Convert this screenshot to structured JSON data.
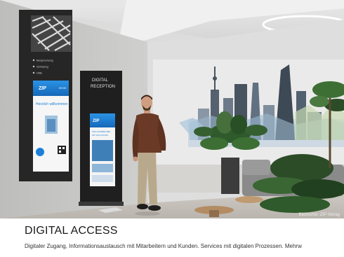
{
  "hero": {
    "credit": "Bildrechte: ZIP-Verlag",
    "stele_left": {
      "menu_items": [
        "Besprechung",
        "Schulung",
        "Hilfe"
      ],
      "brand": "ZIP",
      "greeting": "Herzlich willkommen"
    },
    "stele_right": {
      "header_line1": "DIGITAL",
      "header_line2": "RECEPTION",
      "brand": "ZIP",
      "welcome_line1": "WILLKOMMEN BEI",
      "welcome_line2": "ZIP SOLUTIONS"
    },
    "colors": {
      "screen_blue": "#1d7fd6",
      "stele_dark": "#262626",
      "wall": "#cfcfcd"
    }
  },
  "caption": {
    "title": "DIGITAL ACCESS",
    "description": "Digitaler Zugang, Informationsaustausch mit Mitarbeitern und Kunden. Services mit digitalen Prozessen. Mehrw"
  }
}
